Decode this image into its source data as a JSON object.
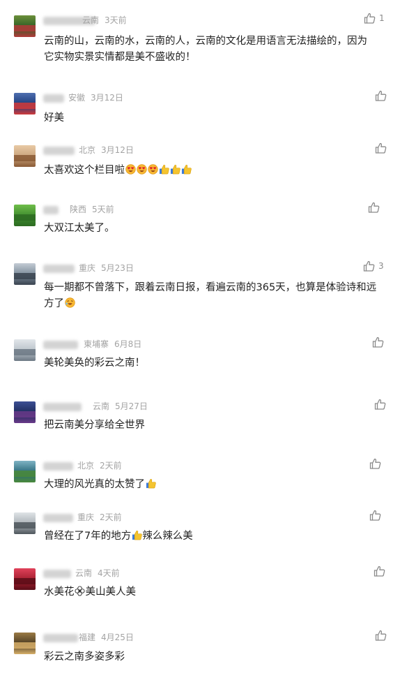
{
  "colors": {
    "text": "#222222",
    "meta": "#a3a3a3",
    "icon": "#8a8a8a"
  },
  "comments": [
    {
      "location": "云南",
      "time": "3天前",
      "likes": "1",
      "lines": [
        "云南的山，云南的水，云南的人，云南的文化是用语言无法描绘的，因为",
        "它实物实景实情都是美不盛收的！"
      ],
      "emoji": [],
      "avatar_colors": [
        "#2f5e25",
        "#6b8f3a",
        "#b33a3a"
      ]
    },
    {
      "location": "安徽",
      "time": "3月12日",
      "likes": "",
      "lines": [
        "好美"
      ],
      "emoji": [],
      "avatar_colors": [
        "#1b3b7a",
        "#4f6fb0",
        "#d23a3a"
      ]
    },
    {
      "location": "北京",
      "time": "3月12日",
      "likes": "",
      "lines": [
        "太喜欢这个栏目啦"
      ],
      "emoji": [
        "heart-eyes",
        "heart-eyes",
        "heart-eyes",
        "thumbs-up",
        "thumbs-up",
        "thumbs-up"
      ],
      "avatar_colors": [
        "#c9a37a",
        "#e8c9a5",
        "#8a5a35"
      ]
    },
    {
      "location": "陕西",
      "time": "5天前",
      "likes": "",
      "lines": [
        "大双江太美了。"
      ],
      "emoji": [],
      "avatar_colors": [
        "#3e8a2e",
        "#6fbe4a",
        "#2d6b22"
      ]
    },
    {
      "location": "重庆",
      "time": "5月23日",
      "likes": "3",
      "lines": [
        "每一期都不曾落下，跟着云南日报，看遍云南的365天，也算是体验诗和远",
        "方了"
      ],
      "emoji": [
        "laugh-cry"
      ],
      "avatar_colors": [
        "#7a8a99",
        "#c4ccd4",
        "#3a4450"
      ]
    },
    {
      "location": "東埔寨",
      "time": "6月8日",
      "likes": "",
      "lines": [
        "美轮美奂的彩云之南！"
      ],
      "emoji": [],
      "avatar_colors": [
        "#b9c2c9",
        "#e2e6ea",
        "#6c7884"
      ]
    },
    {
      "location": "云南",
      "time": "5月27日",
      "likes": "",
      "lines": [
        "把云南美分享给全世界"
      ],
      "emoji": [],
      "avatar_colors": [
        "#1d2a5a",
        "#3c4f94",
        "#6a3a8a"
      ]
    },
    {
      "location": "北京",
      "time": "2天前",
      "likes": "",
      "lines": [
        "大理的风光真的太赞了"
      ],
      "emoji": [
        "thumbs-up"
      ],
      "avatar_colors": [
        "#2a6a7a",
        "#7fb3c4",
        "#4a8a3a"
      ]
    },
    {
      "location": "重庆",
      "time": "2天前",
      "likes": "",
      "lines": [
        "曾经在了7年的地方"
      ],
      "emoji": [
        "thumbs-up"
      ],
      "suffix": "辣么辣么美",
      "avatar_colors": [
        "#a9b0b6",
        "#dfe3e6",
        "#4e565c"
      ]
    },
    {
      "location": "云南",
      "time": "4天前",
      "likes": "",
      "lines": [
        "水美花"
      ],
      "emoji": [
        "flower"
      ],
      "suffix": "美山美人美",
      "avatar_colors": [
        "#a31e2e",
        "#e0415a",
        "#5a0d18"
      ]
    },
    {
      "location": "福建",
      "time": "4月25日",
      "likes": "",
      "lines": [
        "彩云之南多姿多彩"
      ],
      "emoji": [],
      "avatar_colors": [
        "#4a3a22",
        "#9a7a44",
        "#d8b06a"
      ]
    }
  ]
}
